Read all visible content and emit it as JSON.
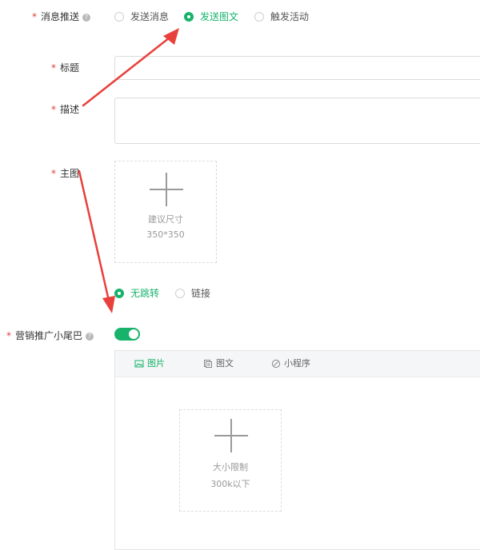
{
  "form": {
    "push": {
      "label": "消息推送",
      "required_mark": "*",
      "help": "?",
      "options": [
        "发送消息",
        "发送图文",
        "触发活动"
      ],
      "selected": "发送图文"
    },
    "title_field": {
      "label": "标题",
      "required_mark": "*",
      "value": ""
    },
    "desc_field": {
      "label": "描述",
      "required_mark": "*",
      "value": ""
    },
    "main_image": {
      "label": "主图",
      "required_mark": "*",
      "hint_line1": "建议尺寸",
      "hint_line2": "350*350"
    },
    "jump": {
      "options": [
        "无跳转",
        "链接"
      ],
      "selected": "无跳转"
    },
    "tail": {
      "label": "营销推广小尾巴",
      "required_mark": "*",
      "help": "?",
      "enabled": true,
      "tabs": [
        {
          "label": "图片",
          "icon": "image-icon"
        },
        {
          "label": "图文",
          "icon": "article-icon"
        },
        {
          "label": "小程序",
          "icon": "miniprogram-icon"
        }
      ],
      "active_tab": "图片",
      "upload_hint_line1": "大小限制",
      "upload_hint_line2": "300k以下"
    }
  },
  "colors": {
    "accent": "#17b36b",
    "required": "#e0403c",
    "annotation_arrow": "#e8403a"
  }
}
